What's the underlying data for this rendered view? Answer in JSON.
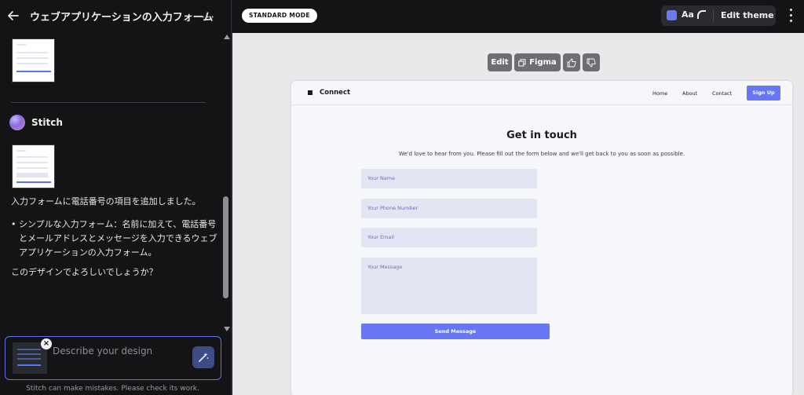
{
  "sidebar": {
    "title": "ウェブアプリケーションの入力フォーム",
    "more_label": "···",
    "assistant_name": "Stitch",
    "messages": {
      "added": "入力フォームに電話番号の項目を追加しました。",
      "bullet": "シンプルな入力フォーム：名前に加えて、電話番号とメールアドレスとメッセージを入力できるウェブアプリケーションの入力フォーム。",
      "question": "このデザインでよろしいでしょうか？"
    },
    "prompt": {
      "placeholder": "Describe your design",
      "close_label": "×"
    },
    "footnote": "Stitch can make mistakes. Please check its work."
  },
  "topbar": {
    "mode": "STANDARD MODE",
    "theme_font_label": "Aa",
    "edit_theme": "Edit theme",
    "accent": "#6979f8"
  },
  "canvas_toolbar": {
    "edit": "Edit",
    "figma": "Figma"
  },
  "preview": {
    "brand": "Connect",
    "nav": [
      "Home",
      "About",
      "Contact"
    ],
    "signup": "Sign Up",
    "heading": "Get in touch",
    "subheading": "We'd love to hear from you. Please fill out the form below and we'll get back to you as soon as possible.",
    "fields": {
      "name": "Your Name",
      "phone": "Your Phone Number",
      "email": "Your Email",
      "message": "Your Message"
    },
    "submit": "Send Message",
    "accent": "#6577f3"
  }
}
